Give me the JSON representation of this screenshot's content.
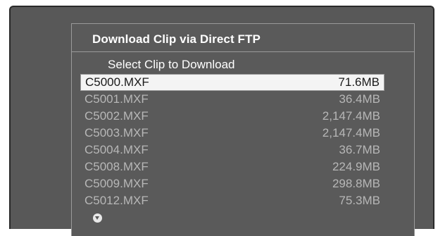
{
  "dialog": {
    "title": "Download Clip via Direct FTP",
    "subtitle": "Select Clip to Download",
    "scroll_icon": "chevron-down-circle-icon"
  },
  "clips": [
    {
      "name": "C5000.MXF",
      "size": "71.6MB",
      "selected": true
    },
    {
      "name": "C5001.MXF",
      "size": "36.4MB",
      "selected": false
    },
    {
      "name": "C5002.MXF",
      "size": "2,147.4MB",
      "selected": false
    },
    {
      "name": "C5003.MXF",
      "size": "2,147.4MB",
      "selected": false
    },
    {
      "name": "C5004.MXF",
      "size": "36.7MB",
      "selected": false
    },
    {
      "name": "C5008.MXF",
      "size": "224.9MB",
      "selected": false
    },
    {
      "name": "C5009.MXF",
      "size": "298.8MB",
      "selected": false
    },
    {
      "name": "C5012.MXF",
      "size": "75.3MB",
      "selected": false
    }
  ],
  "colors": {
    "screen_bg": "#585858",
    "selected_bg": "#f4f4f4",
    "dim_text": "#b7b7b7",
    "title_text": "#ffffff"
  }
}
